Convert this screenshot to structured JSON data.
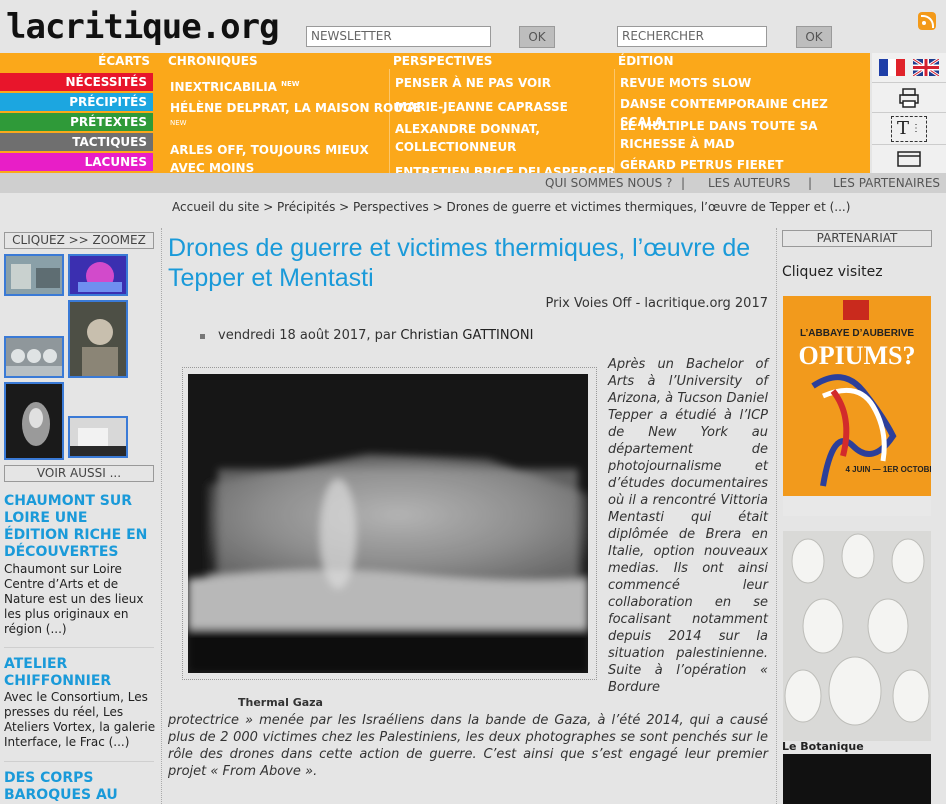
{
  "header": {
    "logo": "lacritique.org",
    "newsletter_placeholder": "NEWSLETTER",
    "newsletter_ok": "OK",
    "search_placeholder": "RECHERCHER",
    "search_ok": "OK"
  },
  "nav": {
    "ecarts": "ÉCARTS",
    "categories": [
      {
        "label": "NÉCESSITÉS",
        "color": "#e8152b"
      },
      {
        "label": "PRÉCIPITÉS",
        "color": "#1ca6e0"
      },
      {
        "label": "PRÉTEXTES",
        "color": "#2f9a39"
      },
      {
        "label": "TACTIQUES",
        "color": "#6f6f6f"
      },
      {
        "label": "LACUNES",
        "color": "#e81ec7"
      }
    ],
    "columns": [
      {
        "heading": "CHRONIQUES",
        "items": [
          "INEXTRICABILIA",
          "HÉLÈNE DELPRAT, LA MAISON ROUGE",
          "ARLES OFF, TOUJOURS MIEUX AVEC MOINS"
        ]
      },
      {
        "heading": "PERSPECTIVES",
        "items": [
          "PENSER À NE PAS VOIR",
          "MARIE-JEANNE CAPRASSE",
          "ALEXANDRE DONNAT, COLLECTIONNEUR",
          "ENTRETIEN BRICE DELASPERGER"
        ]
      },
      {
        "heading": "ÉDITION",
        "items": [
          "REVUE MOTS SLOW",
          "DANSE CONTEMPORAINE CHEZ SCALA",
          "LE MULTIPLE DANS TOUTE SA RICHESSE À MAD",
          "GÉRARD PETRUS FIERET"
        ]
      }
    ],
    "new_badge": "NEW",
    "accent": "#fba81a"
  },
  "tools": {
    "flags": [
      "fr-flag-icon",
      "uk-flag-icon"
    ],
    "icons": [
      "print-icon",
      "text-size-icon",
      "mail-icon"
    ],
    "text_size_glyph": "T"
  },
  "topbar": {
    "links": [
      "QUI SOMMES NOUS ?",
      "LES AUTEURS",
      "LES PARTENAIRES"
    ],
    "separator": "|"
  },
  "breadcrumb": "Accueil du site > Précipités > Perspectives > Drones de guerre et victimes thermiques, l’œuvre de Tepper et (...)",
  "left": {
    "zoom_title": "CLIQUEZ >> ZOOMEZ",
    "see_also_title": "VOIR AUSSI ...",
    "articles": [
      {
        "title": "CHAUMONT SUR LOIRE UNE ÉDITION RICHE EN DÉCOUVERTES",
        "text": "Chaumont sur Loire Centre d’Arts et de Nature est un des lieux les plus originaux en région (...)"
      },
      {
        "title": "ATELIER CHIFFONNIER",
        "text": "Avec le Consortium, Les presses du réel, Les Ateliers Vortex, la galerie Interface, le Frac (...)"
      },
      {
        "title": "DES CORPS BAROQUES AU",
        "text": ""
      }
    ]
  },
  "article": {
    "title": "Drones de guerre et victimes thermiques, l’œuvre de Tepper et Mentasti",
    "subtitle": "Prix Voies Off - lacritique.org 2017",
    "date": "vendredi 18 août 2017, par ",
    "author": "Christian GATTINONI",
    "caption": "Thermal Gaza",
    "text_right": "Après un Bachelor of Arts à l’University of Arizona, à Tucson Daniel Tepper a étudié à l’ICP de New York au département de photojournalisme et d’études documentaires où il a rencontré Vittoria Mentasti qui était diplômée de Brera en Italie, option nouveaux medias. Ils ont ainsi commencé leur collaboration en se focalisant notamment depuis 2014 sur la situation palestinienne. Suite à l’opération « Bordure",
    "text_bottom": "protectrice » menée par les Israéliens dans la bande de Gaza, à l’été 2014, qui a causé plus de 2 000 victimes chez les Palestiniens, les deux photographes se sont penchés sur le rôle des drones dans cette action de guerre. C’est ainsi que s’est engagé leur premier projet « From Above »."
  },
  "right": {
    "partner_title": "PARTENARIAT",
    "click_text": "Cliquez visitez",
    "poster1_top": "L’ABBAYE D’AUBERIVE",
    "poster1_title": "OPIUMS?",
    "poster1_dates": "4 JUIN — 1ER OCTOBRE",
    "poster2_caption": "Le Botanique"
  }
}
